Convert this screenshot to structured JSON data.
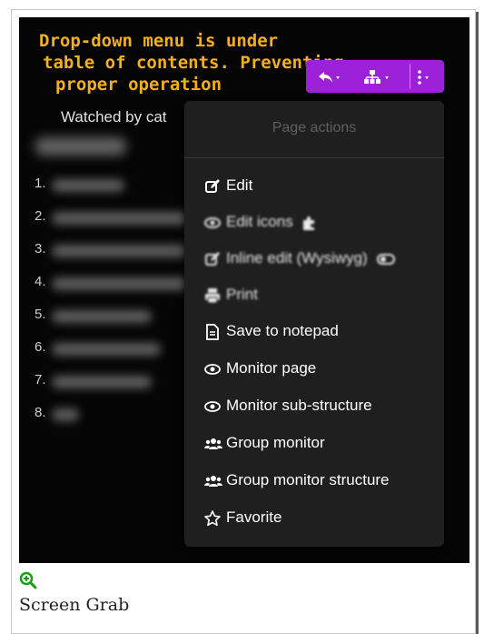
{
  "title_lines": [
    "Drop-down menu is under",
    "table of contents. Preventing",
    "proper operation"
  ],
  "watched_by": "Watched by cat",
  "toc_numbers": [
    "1.",
    "2.",
    "3.",
    "4.",
    "5.",
    "6.",
    "7.",
    "8."
  ],
  "toolbar": {
    "back_icon": "reply-icon",
    "structure_icon": "sitemap-icon",
    "more_icon": "vertical-dots-icon"
  },
  "menu": {
    "header": "Page actions",
    "items": [
      {
        "label": "Edit",
        "icon": "edit-icon"
      },
      {
        "label": "Edit icons",
        "icon": "eye-icon",
        "suffix_icon": "puzzle-icon"
      },
      {
        "label": "Inline edit (Wysiwyg)",
        "icon": "edit-icon",
        "suffix_icon": "toggle-icon"
      },
      {
        "label": "Print",
        "icon": "print-icon"
      },
      {
        "label": "Save to notepad",
        "icon": "file-icon"
      },
      {
        "label": "Monitor page",
        "icon": "eye-icon"
      },
      {
        "label": "Monitor sub-structure",
        "icon": "eye-icon"
      },
      {
        "label": "Group monitor",
        "icon": "users-icon"
      },
      {
        "label": "Group monitor structure",
        "icon": "users-icon"
      },
      {
        "label": "Favorite",
        "icon": "star-icon"
      }
    ]
  },
  "caption": "Screen Grab",
  "colors": {
    "title": "#f2b01e",
    "toolbar": "#9b22d6",
    "menu_bg": "#1f1f1f",
    "zoom_icon": "#1a9c1a"
  }
}
